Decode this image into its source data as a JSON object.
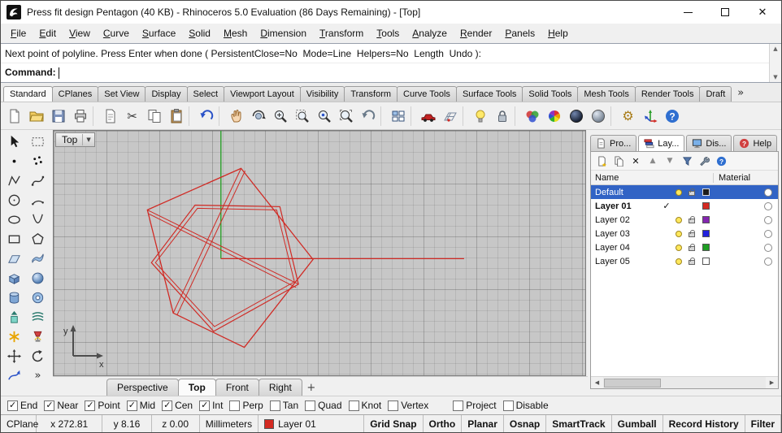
{
  "window": {
    "title": "Press fit design Pentagon (40 KB) - Rhinoceros 5.0 Evaluation (86 Days Remaining) - [Top]"
  },
  "icons": {
    "close": "✕",
    "plus": "+",
    "dropdown": "▼",
    "scroll_up": "▲",
    "scroll_down": "▼",
    "scroll_left": "◀",
    "scroll_right": "▶",
    "chevron_more": "»",
    "cut": "✂",
    "gear": "⚙",
    "delete_x": "✕",
    "question": "?",
    "up_triangle": "▲",
    "down_triangle": "▼",
    "check": "✓"
  },
  "menu": {
    "items": [
      "File",
      "Edit",
      "View",
      "Curve",
      "Surface",
      "Solid",
      "Mesh",
      "Dimension",
      "Transform",
      "Tools",
      "Analyze",
      "Render",
      "Panels",
      "Help"
    ]
  },
  "command": {
    "history": "Next point of polyline. Press Enter when done ( PersistentClose=No  Mode=Line  Helpers=No  Length  Undo ):",
    "prompt": "Command:"
  },
  "toolbar_tabs": {
    "items": [
      "Standard",
      "CPlanes",
      "Set View",
      "Display",
      "Select",
      "Viewport Layout",
      "Visibility",
      "Transform",
      "Curve Tools",
      "Surface Tools",
      "Solid Tools",
      "Mesh Tools",
      "Render Tools",
      "Draft"
    ],
    "active": "Standard"
  },
  "toolbar": {
    "icons": [
      "new-file-icon",
      "open-file-icon",
      "save-icon",
      "print-icon",
      "properties-icon",
      "cut-icon",
      "copy-icon",
      "paste-icon",
      "undo-icon",
      "pan-icon",
      "rotate-view-icon",
      "zoom-dynamic-icon",
      "zoom-window-icon",
      "zoom-selected-icon",
      "zoom-extents-icon",
      "undo-view-icon",
      "viewport-layout-icon",
      "car-icon",
      "cplane-icon",
      "lightbulb-icon",
      "lock-icon",
      "render-icon",
      "color-wheel-icon",
      "shaded-sphere-icon",
      "ghosted-sphere-icon",
      "options-gear-icon",
      "gumball-icon",
      "help-icon"
    ]
  },
  "sidebar": {
    "icons": [
      "select-arrow-icon",
      "marquee-select-icon",
      "point-icon",
      "point-cloud-icon",
      "polyline-icon",
      "curve-icon",
      "circle-icon",
      "arc-icon",
      "ellipse-icon",
      "parabola-icon",
      "rectangle-icon",
      "polygon-icon",
      "plane-surface-icon",
      "surface-from-curves-icon",
      "box-icon",
      "sphere-icon",
      "cylinder-icon",
      "pipe-icon",
      "extrude-icon",
      "loft-icon",
      "fillet-icon",
      "lamp-icon",
      "move-icon",
      "rotate-icon",
      "curve-arrow-icon",
      "more-tools-chevron"
    ]
  },
  "viewport": {
    "label": "Top",
    "axis_x": "x",
    "axis_y": "y"
  },
  "viewport_tabs": {
    "items": [
      "Perspective",
      "Top",
      "Front",
      "Right"
    ],
    "active": "Top"
  },
  "panel": {
    "tabs": [
      "Pro...",
      "Lay...",
      "Dis...",
      "Help"
    ],
    "active_tab": "Lay...",
    "toolbar_icons": [
      "new-layer-icon",
      "new-sublayer-icon",
      "delete-layer-icon",
      "move-up-icon",
      "move-down-icon",
      "filter-icon",
      "layer-tools-icon",
      "panel-help-icon"
    ],
    "columns": [
      "Name",
      "Material"
    ],
    "layers": [
      {
        "name": "Default",
        "check": "",
        "color": "#1c1c1c",
        "selected": true,
        "visible": true,
        "unlocked": true
      },
      {
        "name": "Layer 01",
        "check": "✓",
        "color": "#d42a22",
        "current": true
      },
      {
        "name": "Layer 02",
        "check": "",
        "color": "#8426b0",
        "visible": true,
        "unlocked": true
      },
      {
        "name": "Layer 03",
        "check": "",
        "color": "#2222dd",
        "visible": true,
        "unlocked": true
      },
      {
        "name": "Layer 04",
        "check": "",
        "color": "#1f9e23",
        "visible": true,
        "unlocked": true
      },
      {
        "name": "Layer 05",
        "check": "",
        "color": "#ffffff",
        "visible": true,
        "unlocked": true
      }
    ]
  },
  "osnap": {
    "items": [
      {
        "label": "End",
        "checked": true
      },
      {
        "label": "Near",
        "checked": true
      },
      {
        "label": "Point",
        "checked": true
      },
      {
        "label": "Mid",
        "checked": true
      },
      {
        "label": "Cen",
        "checked": true
      },
      {
        "label": "Int",
        "checked": true
      },
      {
        "label": "Perp",
        "checked": false
      },
      {
        "label": "Tan",
        "checked": false
      },
      {
        "label": "Quad",
        "checked": false
      },
      {
        "label": "Knot",
        "checked": false
      },
      {
        "label": "Vertex",
        "checked": false
      },
      {
        "label": "Project",
        "checked": false
      },
      {
        "label": "Disable",
        "checked": false
      }
    ]
  },
  "status": {
    "cplane_label": "CPlane",
    "x": "x 272.81",
    "y": "y 8.16",
    "z": "z 0.00",
    "units": "Millimeters",
    "layer_name": "Layer 01",
    "layer_color": "#d42a22",
    "buttons": [
      "Grid Snap",
      "Ortho",
      "Planar",
      "Osnap",
      "SmartTrack",
      "Gumball",
      "Record History",
      "Filter"
    ]
  },
  "colors": {
    "selection": "#3163c5",
    "axis_x": "#d02a24",
    "axis_y": "#2ba12b",
    "geometry": "#d02a24",
    "viewport_bg": "#c7c7c7"
  }
}
